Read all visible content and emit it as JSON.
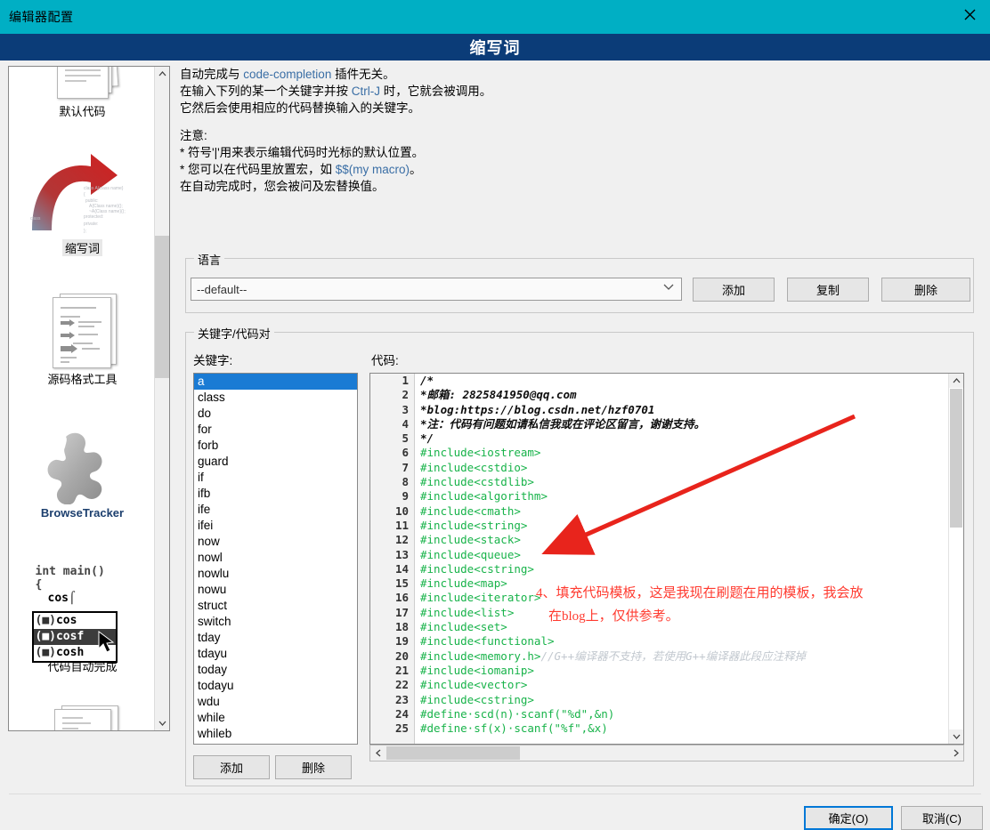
{
  "window": {
    "title": "编辑器配置",
    "close_icon": "close-icon",
    "banner_title": "缩写词",
    "titlebar_color": "#00AFC4",
    "banner_color": "#0b3c78"
  },
  "sidebar": {
    "items": [
      {
        "label": "默认代码",
        "icon": "documents-stack-icon",
        "selected": false
      },
      {
        "label": "缩写词",
        "icon": "red-arrow-class-icon",
        "selected": true
      },
      {
        "label": "源码格式工具",
        "icon": "formatted-document-icon",
        "selected": false
      },
      {
        "label": "BrowseTracker",
        "icon": "puzzle-piece-icon",
        "selected": false
      },
      {
        "label": "代码自动完成",
        "icon": "code-autocomplete-icon",
        "selected": false
      }
    ],
    "autocomplete_preview": {
      "line1": "int main()",
      "line2": "{",
      "line3": "cos",
      "options": [
        "cos",
        "cosf",
        "cosh"
      ],
      "selected_option": "cosf"
    }
  },
  "description": {
    "line1_a": "自动完成与 ",
    "line1_b": "code-completion",
    "line1_c": " 插件无关。",
    "line2_a": "在输入下列的某一个关键字并按 ",
    "line2_b": "Ctrl-J",
    "line2_c": " 时，它就会被调用。",
    "line3": "它然后会使用相应的代码替换输入的关键字。",
    "note_title": "注意:",
    "note1": "* 符号'|'用来表示编辑代码时光标的默认位置。",
    "note2_a": "* 您可以在代码里放置宏，如 ",
    "note2_b": "$$(my macro)",
    "note2_c": "。",
    "note3": "  在自动完成时，您会被问及宏替换值。"
  },
  "language_group": {
    "title": "语言",
    "selected": "--default--",
    "caret_icon": "chevron-down-icon",
    "add_label": "添加",
    "copy_label": "复制",
    "delete_label": "删除"
  },
  "pair_group": {
    "title": "关键字/代码对",
    "keyword_label": "关键字:",
    "code_label": "代码:",
    "add_label": "添加",
    "delete_label": "删除",
    "keywords": [
      "a",
      "class",
      "do",
      "for",
      "forb",
      "guard",
      "if",
      "ifb",
      "ife",
      "ifei",
      "now",
      "nowl",
      "nowlu",
      "nowu",
      "struct",
      "switch",
      "tday",
      "tdayu",
      "today",
      "todayu",
      "wdu",
      "while",
      "whileb"
    ],
    "selected_keyword": "a"
  },
  "code_editor": {
    "line_numbers": [
      "1",
      "2",
      "3",
      "4",
      "5",
      "6",
      "7",
      "8",
      "9",
      "10",
      "11",
      "12",
      "13",
      "14",
      "15",
      "16",
      "17",
      "18",
      "19",
      "20",
      "21",
      "22",
      "23",
      "24",
      "25"
    ],
    "lines": [
      {
        "n": "1",
        "text": "/*",
        "kind": "comment"
      },
      {
        "n": "2",
        "text": "*邮箱: 2825841950@qq.com",
        "kind": "comment"
      },
      {
        "n": "3",
        "text": "*blog:https://blog.csdn.net/hzf0701",
        "kind": "comment"
      },
      {
        "n": "4",
        "text": "*注：代码有问题如请私信我或在评论区留言，谢谢支持。",
        "kind": "comment"
      },
      {
        "n": "5",
        "text": "*/",
        "kind": "comment"
      },
      {
        "n": "6",
        "text": "#include<iostream>",
        "kind": "preproc"
      },
      {
        "n": "7",
        "text": "#include<cstdio>",
        "kind": "preproc"
      },
      {
        "n": "8",
        "text": "#include<cstdlib>",
        "kind": "preproc"
      },
      {
        "n": "9",
        "text": "#include<algorithm>",
        "kind": "preproc"
      },
      {
        "n": "10",
        "text": "#include<cmath>",
        "kind": "preproc"
      },
      {
        "n": "11",
        "text": "#include<string>",
        "kind": "preproc"
      },
      {
        "n": "12",
        "text": "#include<stack>",
        "kind": "preproc"
      },
      {
        "n": "13",
        "text": "#include<queue>",
        "kind": "preproc"
      },
      {
        "n": "14",
        "text": "#include<cstring>",
        "kind": "preproc"
      },
      {
        "n": "15",
        "text": "#include<map>",
        "kind": "preproc"
      },
      {
        "n": "16",
        "text": "#include<iterator>",
        "kind": "preproc"
      },
      {
        "n": "17",
        "text": "#include<list>",
        "kind": "preproc"
      },
      {
        "n": "18",
        "text": "#include<set>",
        "kind": "preproc"
      },
      {
        "n": "19",
        "text": "#include<functional>",
        "kind": "preproc"
      },
      {
        "n": "20",
        "text": "#include<memory.h>",
        "kind": "preproc",
        "trailing_comment": "//G++编译器不支持，若使用G++编译器此段应注释掉"
      },
      {
        "n": "21",
        "text": "#include<iomanip>",
        "kind": "preproc"
      },
      {
        "n": "22",
        "text": "#include<vector>",
        "kind": "preproc"
      },
      {
        "n": "23",
        "text": "#include<cstring>",
        "kind": "preproc"
      },
      {
        "n": "24",
        "text": "#define·scd(n)·scanf(\"%d\",&n)",
        "kind": "preproc"
      },
      {
        "n": "25",
        "text": "#define·sf(x)·scanf(\"%f\",&x)",
        "kind": "preproc"
      }
    ]
  },
  "annotation": {
    "color": "#ff3b30",
    "line1": "4、填充代码模板，这是我现在刷题在用的模板，我会放",
    "line2": "在blog上，仅供参考。",
    "arrow_icon": "red-arrow-annotation"
  },
  "footer": {
    "ok_label": "确定(O)",
    "cancel_label": "取消(C)"
  },
  "scrollbars": {
    "up_arrow": "⌃",
    "down_arrow": "⌄",
    "left_arrow": "‹",
    "right_arrow": "›"
  }
}
